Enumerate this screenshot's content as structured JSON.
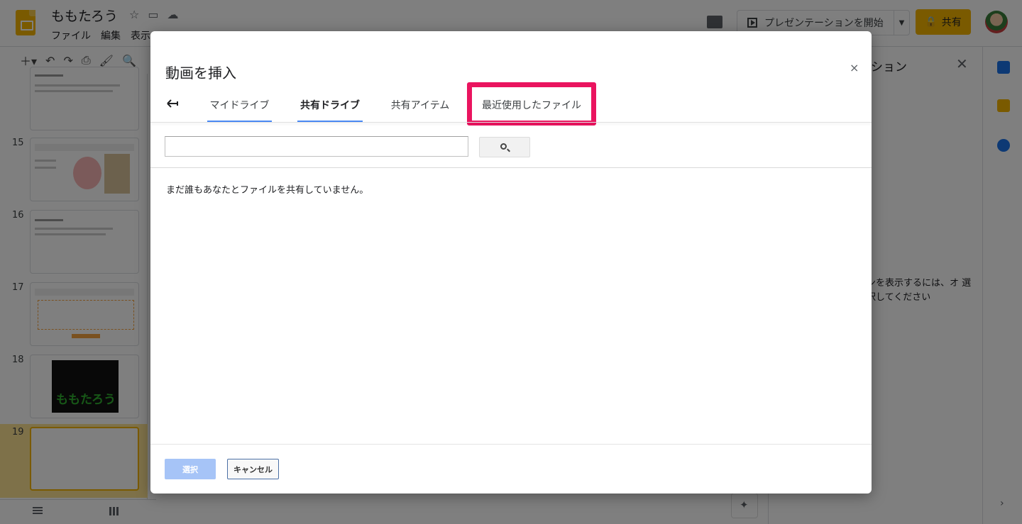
{
  "app": {
    "doc_title": "ももたろう",
    "menu": [
      "ファイル",
      "編集",
      "表示"
    ],
    "present_label": "プレゼンテーションを開始",
    "share_label": "共有"
  },
  "filmstrip": {
    "slides": [
      {
        "number": "",
        "thumb_title": "ももたろう"
      },
      {
        "number": "15",
        "thumb_title": "ストーリー"
      },
      {
        "number": "16",
        "thumb_title": "ももたろう"
      },
      {
        "number": "17",
        "thumb_title": "ももたろうの仲間"
      },
      {
        "number": "18",
        "thumb_title": "ももたろう"
      },
      {
        "number": "19",
        "thumb_title": ""
      }
    ]
  },
  "side_panel": {
    "title": "ション",
    "message": "ンを表示するには、オ 選択してください"
  },
  "dialog": {
    "title": "動画を挿入",
    "close_label": "×",
    "tabs": [
      {
        "label": "マイドライブ"
      },
      {
        "label": "共有ドライブ"
      },
      {
        "label": "共有アイテム"
      },
      {
        "label": "最近使用したファイル"
      }
    ],
    "search": {
      "value": "",
      "placeholder": ""
    },
    "empty_message": "まだ誰もあなたとファイルを共有していません。",
    "select_label": "選択",
    "cancel_label": "キャンセル"
  },
  "colors": {
    "highlight": "#ea145f",
    "tab_underline": "#4a8af4",
    "select_button": "#a6c4f7",
    "accent": "#f4b400"
  }
}
